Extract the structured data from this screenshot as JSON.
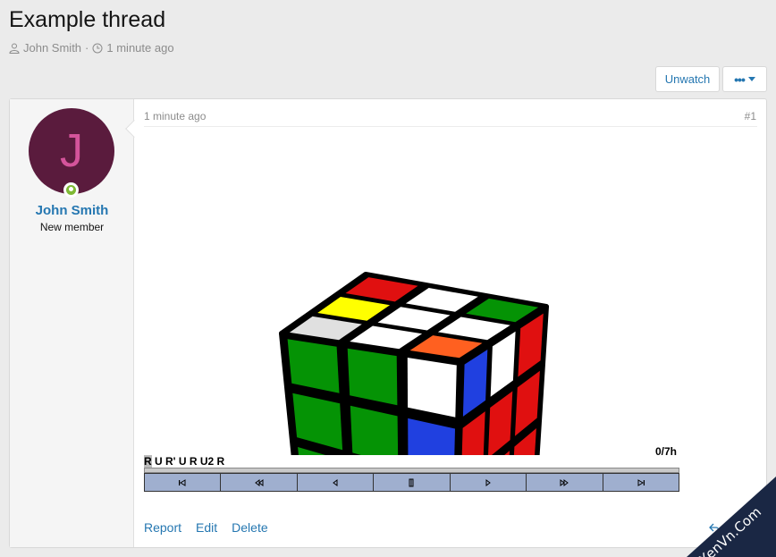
{
  "thread": {
    "title": "Example thread",
    "author": "John Smith",
    "separator": "·",
    "time": "1 minute ago"
  },
  "buttons": {
    "unwatch": "Unwatch",
    "more": "•••"
  },
  "post": {
    "avatar_letter": "J",
    "username": "John Smith",
    "user_title": "New member",
    "time": "1 minute ago",
    "number": "#1",
    "player": {
      "status": "0/7h",
      "algorithm_current": "R",
      "algorithm_rest": " U R' U R U2 R"
    },
    "actions": {
      "report": "Report",
      "edit": "Edit",
      "delete": "Delete",
      "reply": "Reply"
    }
  },
  "cube": {
    "top": [
      "#e01010",
      "#ffffff",
      "#059305",
      "#ffff00",
      "#ffffff",
      "#ffffff",
      "#e0e0e0",
      "#ffffff",
      "#ff6020"
    ],
    "front": [
      "#059305",
      "#059305",
      "#ffffff",
      "#059305",
      "#059305",
      "#2040e0",
      "#059305",
      "#059305",
      "#2040e0"
    ],
    "right": [
      "#2040e0",
      "#ffffff",
      "#e01010",
      "#e01010",
      "#e01010",
      "#e01010",
      "#e01010",
      "#e01010",
      "#e01010"
    ]
  },
  "watermark": "XenVn.Com"
}
